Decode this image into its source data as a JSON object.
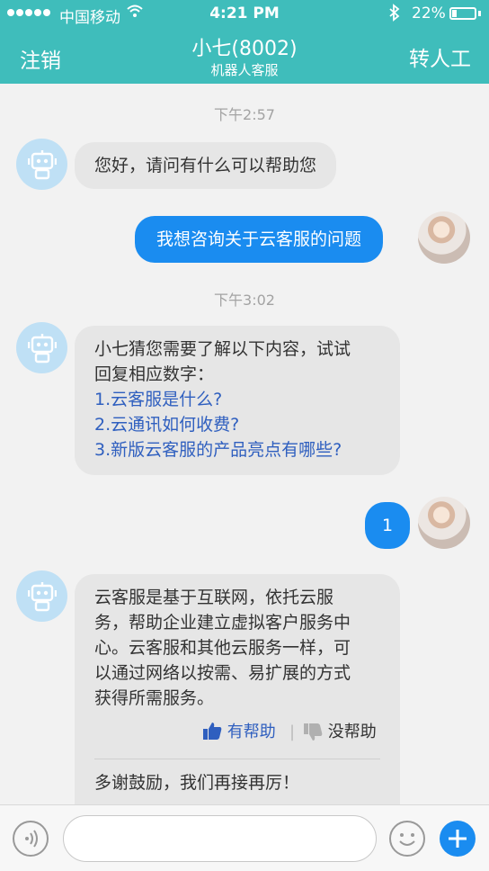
{
  "status": {
    "carrier": "中国移动",
    "time": "4:21 PM",
    "battery": "22%",
    "battery_level": 0.22
  },
  "nav": {
    "left": "注销",
    "title": "小七(8002)",
    "subtitle": "机器人客服",
    "right": "转人工"
  },
  "messages": {
    "ts1": "下午2:57",
    "m1": "您好，请问有什么可以帮助您",
    "m2": "我想咨询关于云客服的问题",
    "ts2": "下午3:02",
    "m3": {
      "intro1": "小七猜您需要了解以下内容，试试",
      "intro2": "回复相应数字：",
      "opt1": "1.云客服是什么?",
      "opt2": "2.云通讯如何收费?",
      "opt3": "3.新版云客服的产品亮点有哪些?"
    },
    "m4": "1",
    "m5": {
      "l1": "云客服是基于互联网，依托云服",
      "l2": "务，帮助企业建立虚拟客户服务中",
      "l3": "心。云客服和其他云服务一样，可",
      "l4": "以通过网络以按需、易扩展的方式",
      "l5": "获得所需服务。",
      "helpful": "有帮助",
      "unhelpful": "没帮助",
      "footer": "多谢鼓励，我们再接再厉！"
    }
  },
  "input": {
    "placeholder": ""
  }
}
